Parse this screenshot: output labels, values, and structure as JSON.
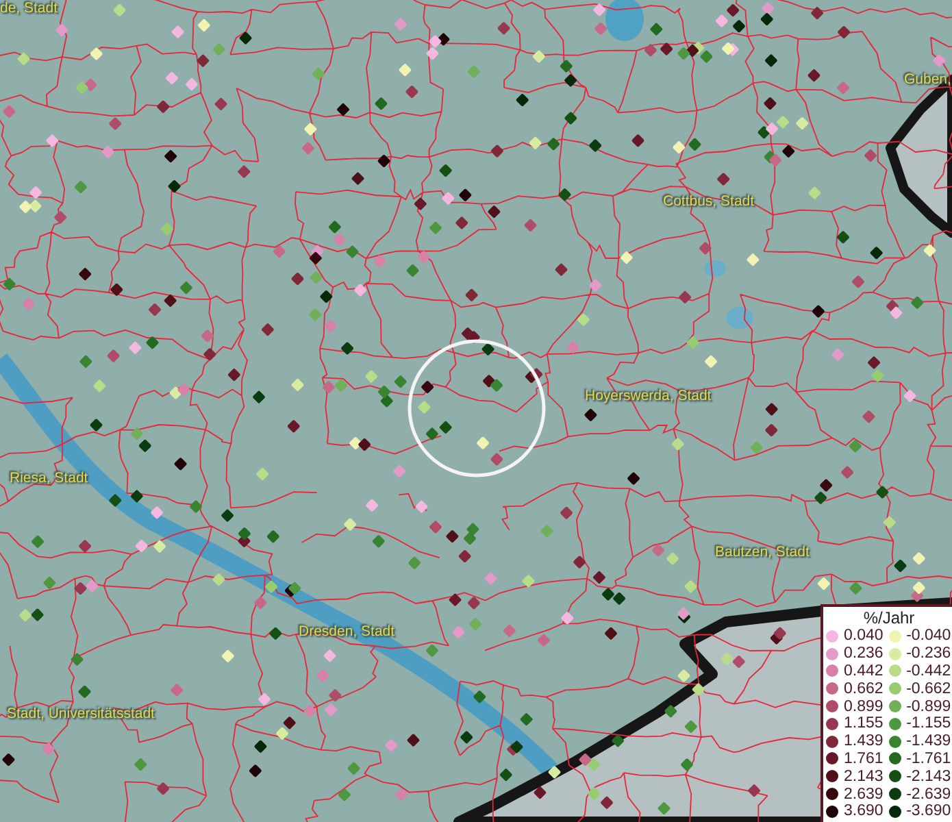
{
  "map": {
    "place_labels": [
      {
        "text": "de, Stadt"
      },
      {
        "text": "Guben,"
      },
      {
        "text": "Cottbus, Stadt"
      },
      {
        "text": "Hoyerswerda, Stadt"
      },
      {
        "text": "Riesa, Stadt"
      },
      {
        "text": "Bautzen, Stadt"
      },
      {
        "text": "Dresden, Stadt"
      },
      {
        "text": "Stadt, Universitätsstadt"
      }
    ]
  },
  "legend": {
    "title": "%/Jahr",
    "positive": [
      {
        "label": "0.040",
        "color": "#f4b8e0"
      },
      {
        "label": "0.236",
        "color": "#e49ac8"
      },
      {
        "label": "0.442",
        "color": "#d880a8"
      },
      {
        "label": "0.662",
        "color": "#c86888"
      },
      {
        "label": "0.899",
        "color": "#b04c68"
      },
      {
        "label": "1.155",
        "color": "#983850"
      },
      {
        "label": "1.439",
        "color": "#802838"
      },
      {
        "label": "1.761",
        "color": "#681828"
      },
      {
        "label": "2.143",
        "color": "#501018"
      },
      {
        "label": "2.639",
        "color": "#380810"
      },
      {
        "label": "3.690",
        "color": "#200408"
      }
    ],
    "negative": [
      {
        "label": "-0.040",
        "color": "#f0f4b0"
      },
      {
        "label": "-0.236",
        "color": "#d8eca0"
      },
      {
        "label": "-0.442",
        "color": "#b8dc88"
      },
      {
        "label": "-0.662",
        "color": "#98cc70"
      },
      {
        "label": "-0.899",
        "color": "#70b058"
      },
      {
        "label": "-1.155",
        "color": "#509840"
      },
      {
        "label": "-1.439",
        "color": "#388430"
      },
      {
        "label": "-1.761",
        "color": "#226a20"
      },
      {
        "label": "-2.143",
        "color": "#145014"
      },
      {
        "label": "-2.639",
        "color": "#0a3c10"
      },
      {
        "label": "-3.690",
        "color": "#042808"
      }
    ]
  }
}
